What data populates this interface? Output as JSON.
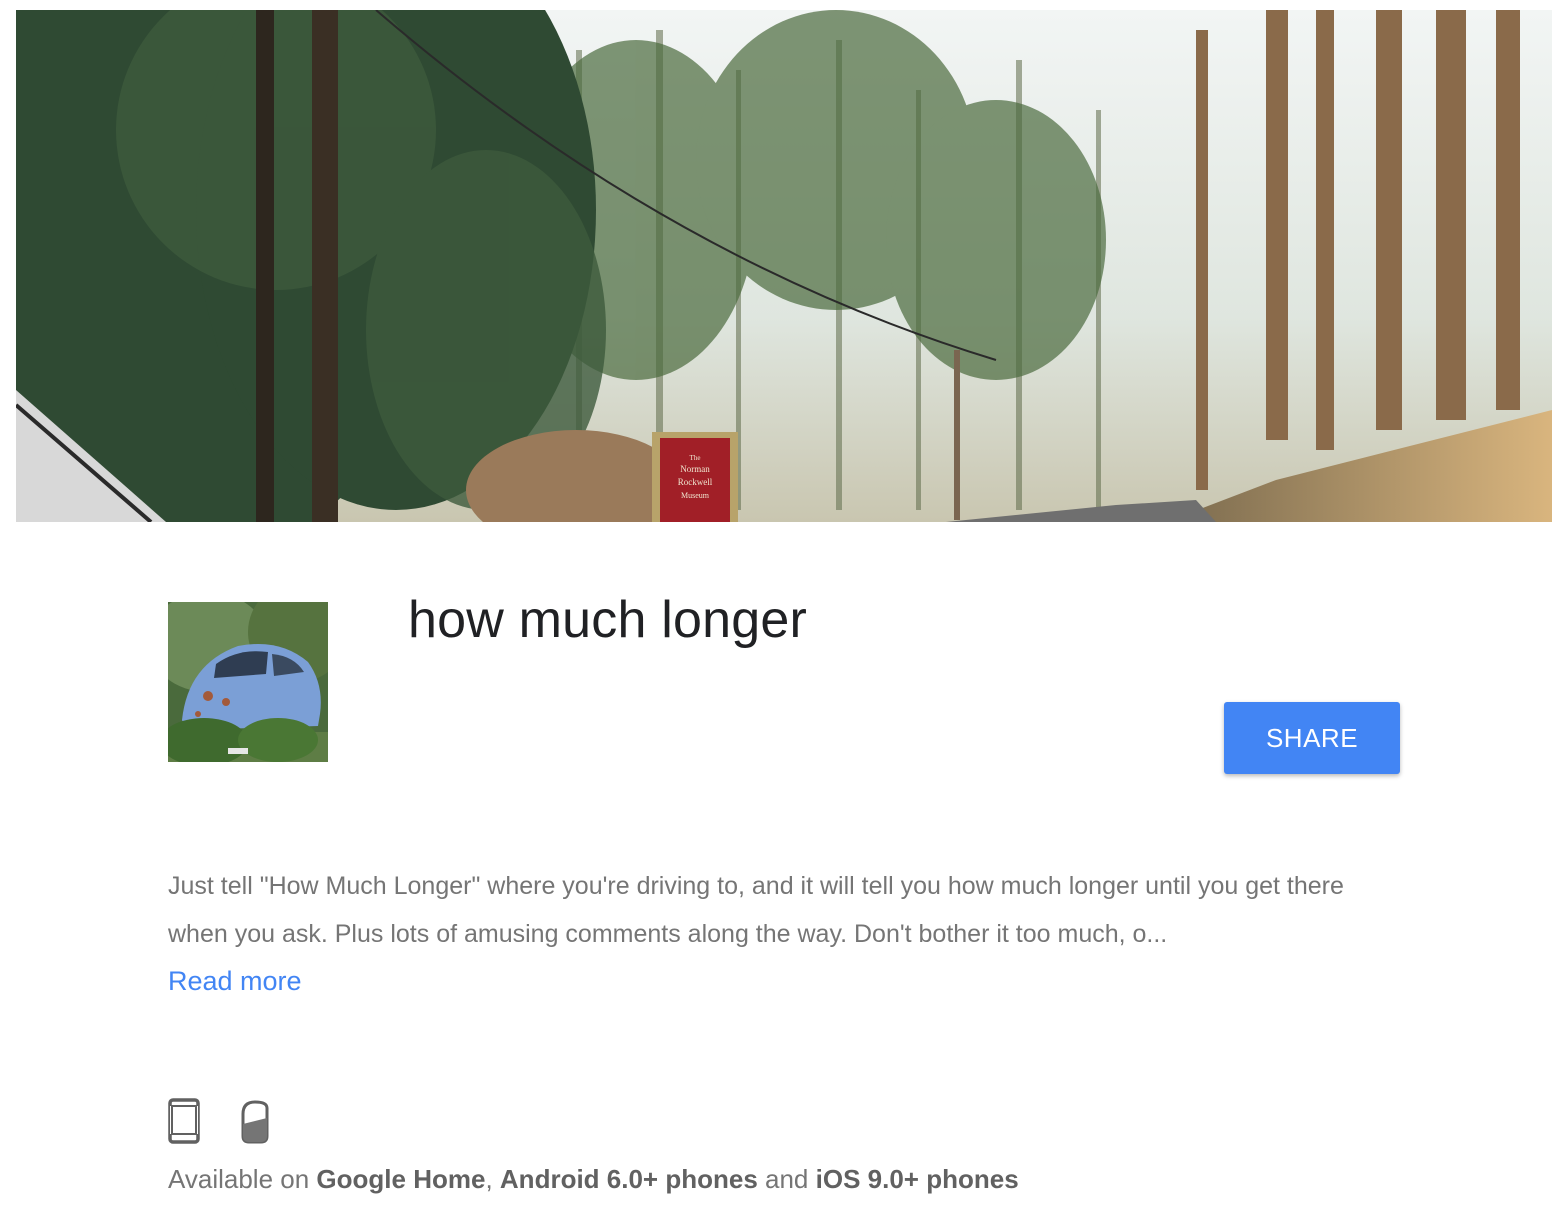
{
  "app": {
    "title": "how much longer",
    "share_label": "SHARE",
    "description": "Just tell \"How Much Longer\" where you're driving to, and it will tell you how much longer until you get there when you ask. Plus lots of amusing comments along the way. Don't bother it too much, o...",
    "read_more_label": "Read more"
  },
  "hero": {
    "sign_lines": [
      "The",
      "Norman",
      "Rockwell",
      "Museum"
    ]
  },
  "surfaces": {
    "icons": [
      "phone-icon",
      "google-home-icon"
    ],
    "prefix": "Available on",
    "platform_1": "Google Home",
    "separator_1": ",",
    "platform_2": "Android 6.0+ phones",
    "separator_2": "and",
    "platform_3": "iOS 9.0+ phones"
  },
  "colors": {
    "accent": "#4285f4",
    "title_text": "#202124",
    "body_text": "#757575"
  }
}
